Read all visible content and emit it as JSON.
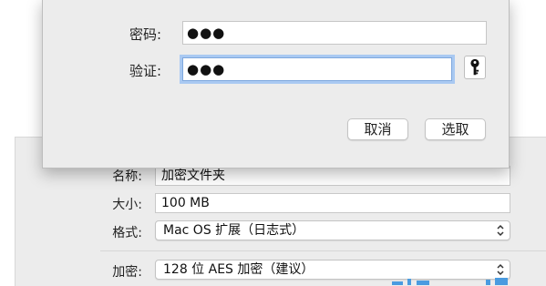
{
  "background_window": {
    "name_label": "名称:",
    "name_value": "加密文件夹",
    "size_label": "大小:",
    "size_value": "100 MB",
    "format_label": "格式:",
    "format_value": "Mac OS 扩展（日志式）",
    "encryption_label": "加密:",
    "encryption_value": "128 位 AES 加密（建议）"
  },
  "password_sheet": {
    "password_label": "密码:",
    "password_value": "●●●",
    "verify_label": "验证:",
    "verify_value": "●●●",
    "key_button_icon": "key-icon",
    "cancel_label": "取消",
    "choose_label": "选取"
  },
  "colors": {
    "focus_ring": "#a9c9f2",
    "panel_bg": "#ececec"
  }
}
